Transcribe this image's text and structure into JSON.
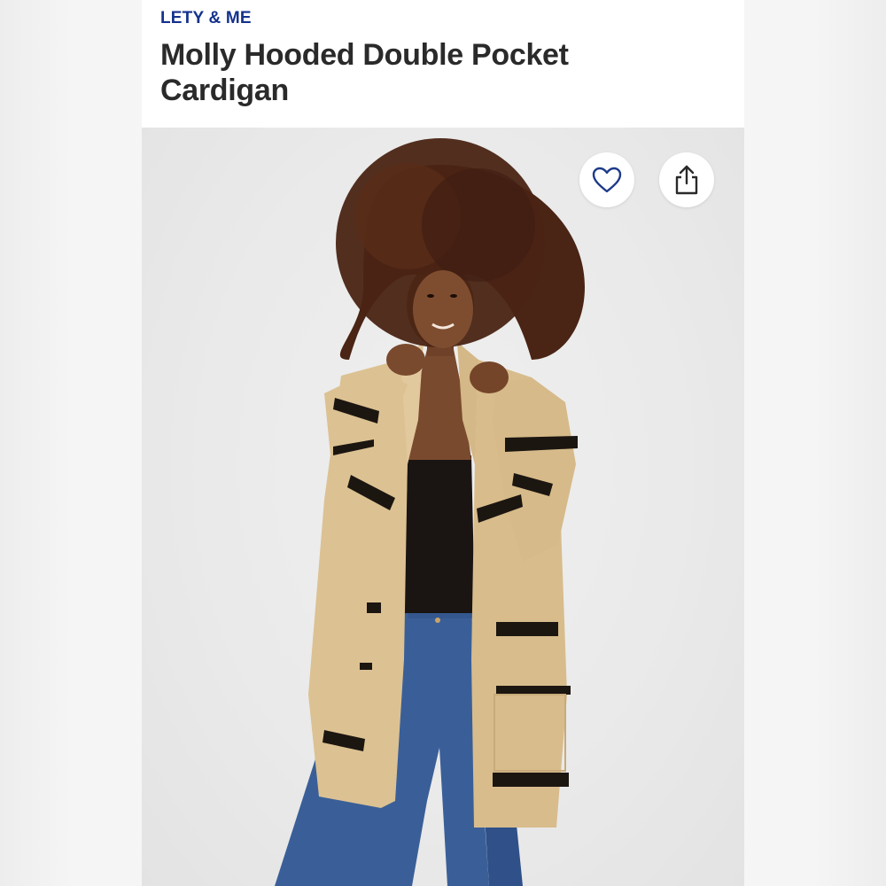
{
  "product": {
    "brand": "LETY & ME",
    "title": "Molly Hooded Double Pocket Cardigan"
  },
  "actions": {
    "favorite_icon": "heart-icon",
    "share_icon": "share-icon"
  },
  "colors": {
    "brand": "#14318c",
    "title": "#2a2a2a",
    "cardigan": "#dcc192",
    "stripe": "#1c1611",
    "denim": "#3a5f98"
  }
}
